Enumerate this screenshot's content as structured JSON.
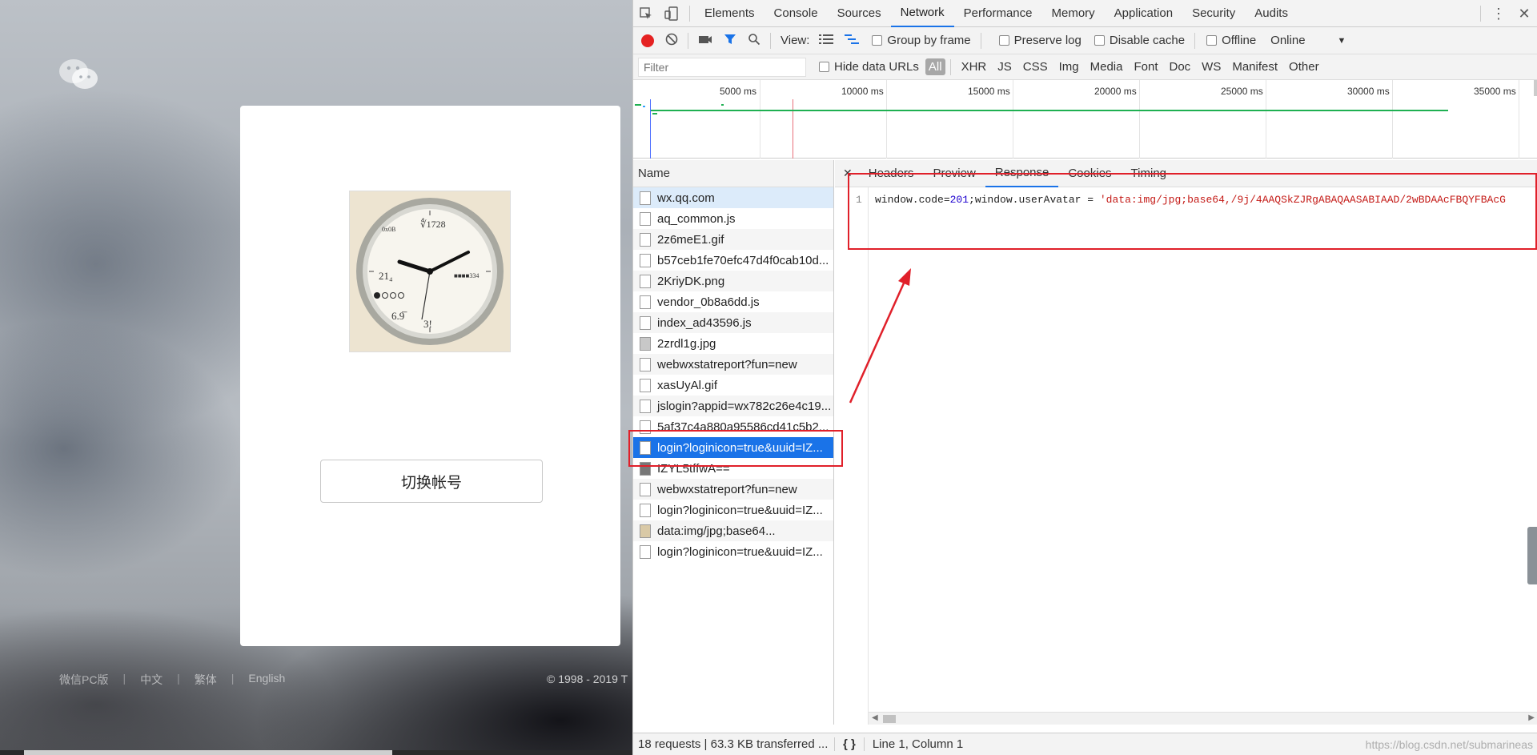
{
  "login_page": {
    "switch_account": "切换帐号",
    "footer_links": [
      "微信PC版",
      "中文",
      "繁体",
      "English"
    ],
    "copyright": "© 1998 - 2019 T"
  },
  "devtools": {
    "panel_tabs": [
      "Elements",
      "Console",
      "Sources",
      "Network",
      "Performance",
      "Memory",
      "Application",
      "Security",
      "Audits"
    ],
    "active_panel": "Network",
    "toolbar": {
      "view_label": "View:",
      "group_by_frame": "Group by frame",
      "preserve_log": "Preserve log",
      "disable_cache": "Disable cache",
      "offline": "Offline",
      "throttle": "Online"
    },
    "filter": {
      "placeholder": "Filter",
      "hide_data_urls": "Hide data URLs",
      "types": [
        "All",
        "XHR",
        "JS",
        "CSS",
        "Img",
        "Media",
        "Font",
        "Doc",
        "WS",
        "Manifest",
        "Other"
      ]
    },
    "overview_ticks": [
      "5000 ms",
      "10000 ms",
      "15000 ms",
      "20000 ms",
      "25000 ms",
      "30000 ms",
      "35000 ms"
    ],
    "name_header": "Name",
    "requests": [
      "wx.qq.com",
      "aq_common.js",
      "2z6meE1.gif",
      "b57ceb1fe70efc47d4f0cab10d...",
      "2KriyDK.png",
      "vendor_0b8a6dd.js",
      "index_ad43596.js",
      "2zrdl1g.jpg",
      "webwxstatreport?fun=new",
      "xasUyAl.gif",
      "jslogin?appid=wx782c26e4c19...",
      "5af37c4a880a95586cd41c5b2...",
      "login?loginicon=true&uuid=IZ...",
      "IZYL5tffwA==",
      "webwxstatreport?fun=new",
      "login?loginicon=true&uuid=IZ...",
      "data:img/jpg;base64...",
      "login?loginicon=true&uuid=IZ..."
    ],
    "detail_tabs": [
      "Headers",
      "Preview",
      "Response",
      "Cookies",
      "Timing"
    ],
    "active_detail_tab": "Response",
    "response": {
      "line_number": "1",
      "code_prefix": "window.code=",
      "code_num": "201",
      "code_mid": ";window.userAvatar = ",
      "code_str": "'data:img/jpg;base64,/9j/4AAQSkZJRgABAQAASABIAAD/2wBDAAcFBQYFBAcG"
    },
    "status": {
      "summary": "18 requests  |  63.3 KB transferred  ...",
      "cursor": "Line 1, Column 1",
      "watermark": "https://blog.csdn.net/submarineas"
    }
  },
  "colors": {
    "accent": "#1a73e8",
    "annotation_red": "#e0202a",
    "timeline_green": "#1fb052"
  }
}
